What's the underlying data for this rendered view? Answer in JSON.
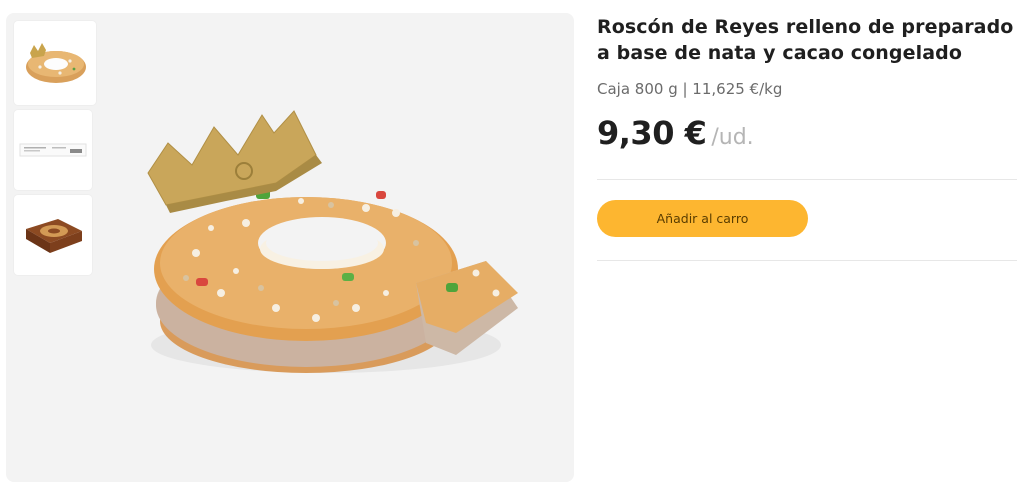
{
  "product": {
    "title": "Roscón de Reyes relleno de preparado a base de nata y cacao congelado",
    "format": "Caja 800 g | 11,625 €/kg",
    "price": "9,30 €",
    "unit": "/ud."
  },
  "actions": {
    "add_to_cart_label": "Añadir al carro"
  },
  "gallery": {
    "thumbnails": [
      {
        "depicts": "roscon-cake",
        "selected": true
      },
      {
        "depicts": "product-label",
        "selected": false
      },
      {
        "depicts": "product-box",
        "selected": false
      }
    ],
    "main_image": "roscon-cake"
  },
  "colors": {
    "accent_button": "#fdb630",
    "gallery_background": "#f3f3f3",
    "muted_text": "#6b6b6b",
    "unit_text": "#b5b5b5"
  }
}
